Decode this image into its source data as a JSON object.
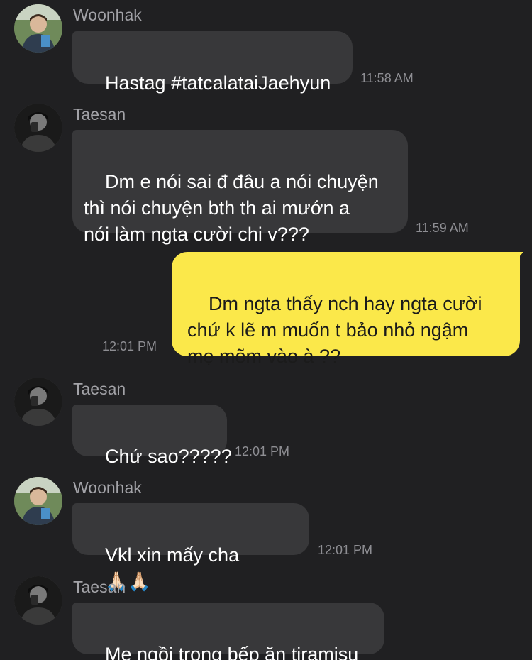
{
  "messages": [
    {
      "sender": "Woonhak",
      "avatar_icon": "woonhak-avatar-icon",
      "text": "Hastag #tatcalataiJaehyun",
      "time": "11:58 AM",
      "direction": "in"
    },
    {
      "sender": "Taesan",
      "avatar_icon": "taesan-avatar-icon",
      "text": "Dm e nói sai đ đâu a nói chuyện\nthì nói chuyện bth th ai mướn a\nnói làm ngta cười chi v???",
      "time": "11:59 AM",
      "direction": "in"
    },
    {
      "sender": "",
      "text": "Dm ngta thấy nch hay ngta cười\nchứ k lẽ m muốn t bảo nhỏ ngậm\nmẹ mõm vào à ??",
      "time": "12:01 PM",
      "direction": "out"
    },
    {
      "sender": "Taesan",
      "avatar_icon": "taesan-avatar-icon",
      "text": "Chứ sao?????",
      "time": "12:01 PM",
      "direction": "in"
    },
    {
      "sender": "Woonhak",
      "avatar_icon": "woonhak-avatar-icon",
      "text": "Vkl xin mấy cha",
      "emoji": "🙏🏻🙏🏻",
      "time": "12:01 PM",
      "direction": "in"
    },
    {
      "sender": "Taesan",
      "avatar_icon": "taesan-avatar-icon",
      "text": "Mẹ ngồi trong bếp ăn tiramisu",
      "time": "",
      "direction": "in"
    }
  ],
  "colors": {
    "background": "#202022",
    "incoming_bubble": "#38383a",
    "outgoing_bubble": "#fbe84a",
    "sender_name": "#a3a3a8",
    "timestamp": "#8e8e93"
  }
}
